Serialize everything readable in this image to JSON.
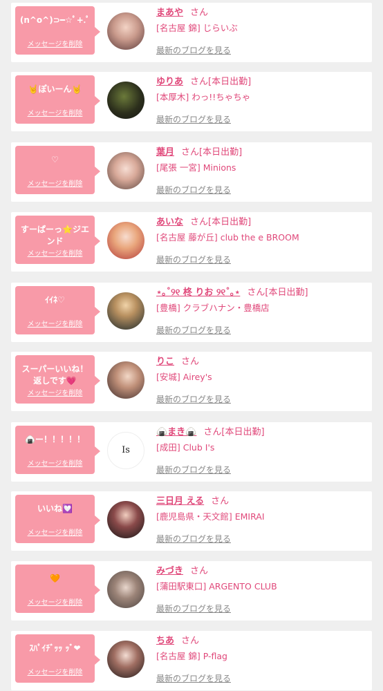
{
  "delete_label": "メッセージを削除",
  "blog_label": "最新のブログを見る",
  "honorific": "さん",
  "accent_color": "#f89aa8",
  "cards": [
    {
      "message": "(n^o^)⊃━☆ﾟ+.ﾟ",
      "name": "まあや",
      "status": "",
      "shop": "[名古屋 錦] じらいぶ"
    },
    {
      "message": "🤘ぽいーん🤘",
      "name": "ゆりあ",
      "status": "[本日出勤]",
      "shop": "[本厚木] わっ!!ちゃちゃ"
    },
    {
      "message": "♡",
      "name": "葉月",
      "status": "[本日出勤]",
      "shop": "[尾張 一宮] Minions"
    },
    {
      "message": "すーぱーっ⭐ジエンド",
      "name": "あいな",
      "status": "[本日出勤]",
      "shop": "[名古屋 藤が丘] club the e BROOM"
    },
    {
      "message": "ｲｲﾈ♡",
      "name": "⋆｡˚୨୧ 柊 りお ୨୧˚｡⋆",
      "status": "[本日出勤]",
      "shop": "[豊橋] クラブハナン・豊橋店"
    },
    {
      "message": "スーパーいいね！返しです💗",
      "name": "りこ",
      "status": "",
      "shop": "[安城] Airey's"
    },
    {
      "message": "🍙ー！！！！！",
      "name": "🍙まき🍙",
      "status": "[本日出勤]",
      "shop": "[成田] Club I's",
      "logo_text": "Is"
    },
    {
      "message": "いいね💟",
      "name": "三日月 える",
      "status": "",
      "shop": "[鹿児島県・天文館] EMIRAI"
    },
    {
      "message": "🧡",
      "name": "みづき",
      "status": "",
      "shop": "[蒲田駅東口] ARGENTO CLUB"
    },
    {
      "message": "ｽﾊﾟｲﾁﾞｯｯ ｯﾞ❤",
      "name": "ちあ",
      "status": "",
      "shop": "[名古屋 錦] P-flag"
    }
  ]
}
